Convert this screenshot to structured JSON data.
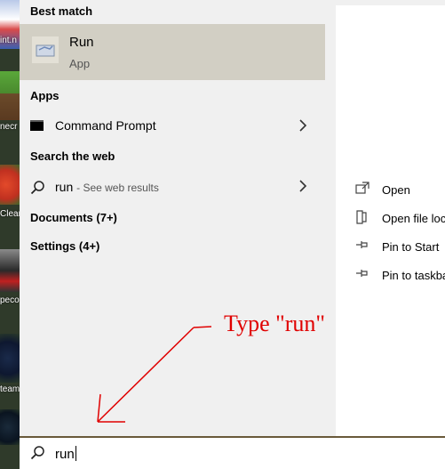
{
  "desktop": {
    "labels": [
      "int.n",
      "necr",
      "Clean",
      "peco",
      "team"
    ]
  },
  "results": {
    "best_match_header": "Best match",
    "best_match": {
      "title": "Run",
      "subtitle": "App"
    },
    "apps_header": "Apps",
    "apps": [
      {
        "label": "Command Prompt"
      }
    ],
    "web_header": "Search the web",
    "web": {
      "query": "run",
      "suffix": "- See web results"
    },
    "documents": "Documents (7+)",
    "settings": "Settings (4+)"
  },
  "details": {
    "actions": [
      {
        "label": "Open",
        "icon": "open-icon"
      },
      {
        "label": "Open file location",
        "icon": "folder-icon"
      },
      {
        "label": "Pin to Start",
        "icon": "pin-icon"
      },
      {
        "label": "Pin to taskbar",
        "icon": "pin-icon"
      }
    ]
  },
  "search": {
    "value": "run"
  },
  "annotation": {
    "text": "Type \"run\"",
    "color": "#e00000"
  },
  "colors": {
    "selected": "#d2cfc4",
    "panel": "#f0f0f0",
    "accent_border": "#6a5a3a"
  }
}
